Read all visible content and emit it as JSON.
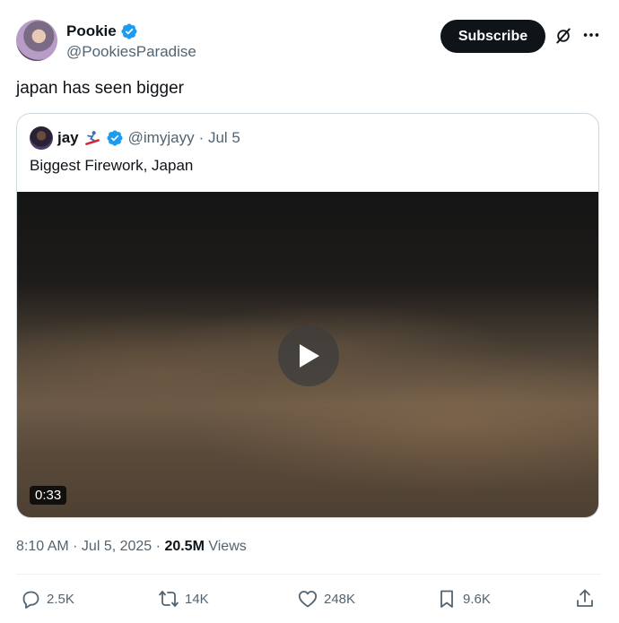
{
  "tweet": {
    "author": {
      "name": "Pookie",
      "handle": "@PookiesParadise"
    },
    "subscribe_label": "Subscribe",
    "text": "japan has seen bigger",
    "timestamp": "8:10 AM · Jul 5, 2025",
    "views_count": "20.5M",
    "views_label": "Views"
  },
  "quote": {
    "author": {
      "name": "jay",
      "handle": "@imyjayy",
      "date": "· Jul 5"
    },
    "text": "Biggest Firework, Japan",
    "video": {
      "duration": "0:33"
    }
  },
  "actions": {
    "replies": "2.5K",
    "reposts": "14K",
    "likes": "248K",
    "bookmarks": "9.6K"
  },
  "colors": {
    "verified": "#1d9bf0",
    "text": "#0f1419",
    "secondary": "#536471"
  }
}
